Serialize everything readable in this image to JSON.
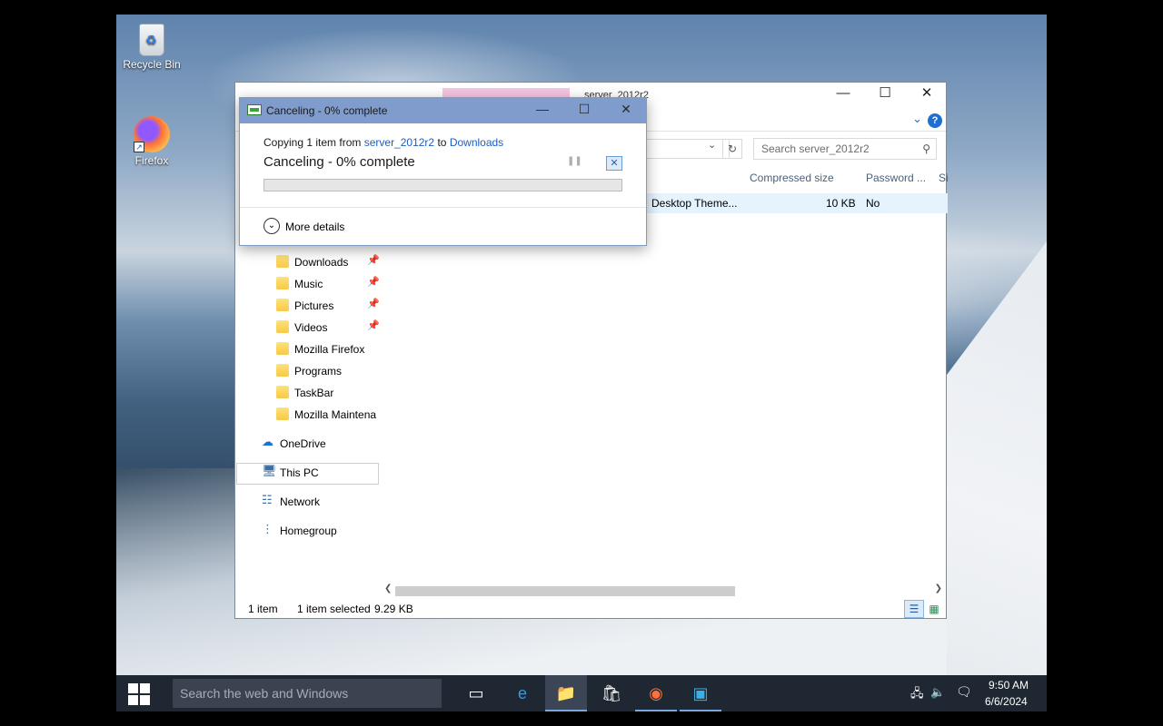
{
  "desktop": {
    "icons": [
      {
        "label": "Recycle Bin",
        "icon": "recycle-bin-icon"
      },
      {
        "label": "Firefox",
        "icon": "firefox-icon"
      }
    ]
  },
  "explorer": {
    "title_fragment": "server_2012r2",
    "search_placeholder": "Search server_2012r2",
    "columns": [
      "Compressed size",
      "Password ...",
      "Si"
    ],
    "file_row": {
      "type": "Desktop Theme...",
      "compressed_size": "10 KB",
      "password": "No"
    },
    "nav_items": [
      {
        "label": "Downloads",
        "icon": "downloads-folder-icon",
        "pinned": true
      },
      {
        "label": "Music",
        "icon": "music-folder-icon",
        "pinned": true
      },
      {
        "label": "Pictures",
        "icon": "pictures-folder-icon",
        "pinned": true
      },
      {
        "label": "Videos",
        "icon": "videos-folder-icon",
        "pinned": true
      },
      {
        "label": "Mozilla Firefox",
        "icon": "folder-icon",
        "pinned": false
      },
      {
        "label": "Programs",
        "icon": "folder-icon",
        "pinned": false
      },
      {
        "label": "TaskBar",
        "icon": "folder-icon",
        "pinned": false
      },
      {
        "label": "Mozilla Maintena",
        "icon": "folder-icon",
        "pinned": false
      },
      {
        "label": "OneDrive",
        "icon": "onedrive-icon",
        "pinned": false
      },
      {
        "label": "This PC",
        "icon": "this-pc-icon",
        "pinned": false
      },
      {
        "label": "Network",
        "icon": "network-icon",
        "pinned": false
      },
      {
        "label": "Homegroup",
        "icon": "homegroup-icon",
        "pinned": false
      }
    ],
    "status": {
      "items": "1 item",
      "selected": "1 item selected",
      "size": "9.29 KB"
    }
  },
  "copy_dialog": {
    "title": "Canceling - 0% complete",
    "copying_prefix": "Copying 1 item from",
    "source": "server_2012r2",
    "to": "to",
    "destination": "Downloads",
    "status": "Canceling - 0% complete",
    "progress": 0,
    "more_details": "More details"
  },
  "taskbar": {
    "search_placeholder": "Search the web and Windows",
    "apps": [
      "task-view-icon",
      "edge-icon",
      "file-explorer-icon",
      "store-icon",
      "firefox-icon",
      "remote-desktop-icon"
    ],
    "time": "9:50 AM",
    "date": "6/6/2024"
  },
  "colors": {
    "accent": "#1a5fbf",
    "taskbar": "#1f2733",
    "dialog_titlebar": "#7f9ccc"
  }
}
